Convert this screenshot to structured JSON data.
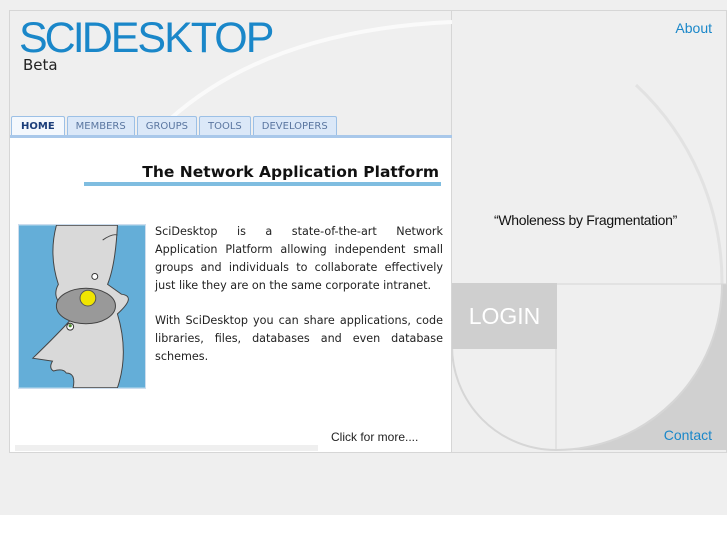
{
  "logo": {
    "sci": "SCI",
    "desktop": "DESKTOP",
    "beta": "Beta"
  },
  "tabs": [
    {
      "label": "HOME",
      "active": true
    },
    {
      "label": "MEMBERS"
    },
    {
      "label": "GROUPS"
    },
    {
      "label": "TOOLS"
    },
    {
      "label": "DEVELOPERS"
    }
  ],
  "main": {
    "title": "The Network Application Platform",
    "paragraphs": [
      "SciDesktop is a state-of-the-art Network Application Platform allowing independent small groups and individuals to collaborate effectively just like they are on the same corporate intranet.",
      "With SciDesktop you can share applications, code libraries, files, databases and even database schemes."
    ],
    "more_link": "Click for more...."
  },
  "right": {
    "about": "About",
    "quote": "“Wholeness by Fragmentation”",
    "login": "LOGIN",
    "contact": "Contact"
  },
  "colors": {
    "brand": "#1a87c9",
    "tab_bg": "#dbe8f8",
    "underline": "#7fbde0"
  }
}
